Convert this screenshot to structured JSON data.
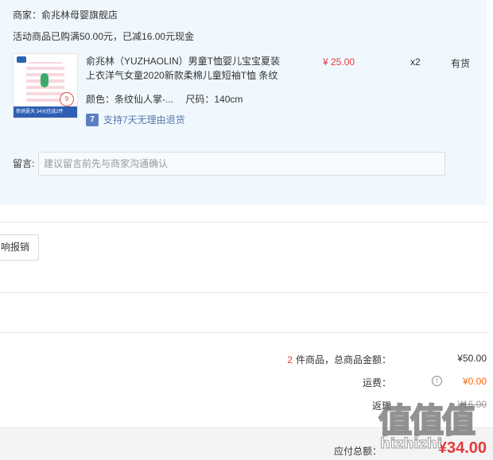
{
  "store": {
    "merchant": "商家：俞兆林母婴旗舰店",
    "promo": "活动商品已购满50.00元，已减16.00元现金",
    "thumbnail": {
      "badge": "9",
      "strip_text": "热销夏天 34元任选2件"
    }
  },
  "item": {
    "title": "俞兆林（YUZHAOLIN）男童T恤婴儿宝宝夏装上衣洋气女童2020新款柔棉儿童短袖T恤 条纹",
    "color_spec": "颜色：条纹仙人掌-...",
    "size_spec": "尺码：140cm",
    "return_icon": "7",
    "return_policy": "支持7天无理由退货",
    "unit_price": "¥ 25.00",
    "quantity": "x2",
    "stock": "有货"
  },
  "memo": {
    "label": "留言:",
    "placeholder": "建议留言前先与商家沟通确认",
    "value": ""
  },
  "invoice": {
    "button_label": "响报销"
  },
  "summary": {
    "count": "2",
    "goods_label": "件商品，总商品金额：",
    "goods_value": "¥50.00",
    "shipping_label": "运费：",
    "shipping_value": "¥0.00",
    "info_icon": "!",
    "cashback_label": "返现",
    "cashback_value": "¥16.00"
  },
  "total": {
    "label": "应付总额：",
    "value": "¥34.00"
  },
  "watermark": {
    "glyphs": "值值值",
    "text": "hizhizhi"
  },
  "colors": {
    "panel_bg": "#f0f8fe",
    "price_red": "#e4393c",
    "shipping_orange": "#ff6600"
  }
}
